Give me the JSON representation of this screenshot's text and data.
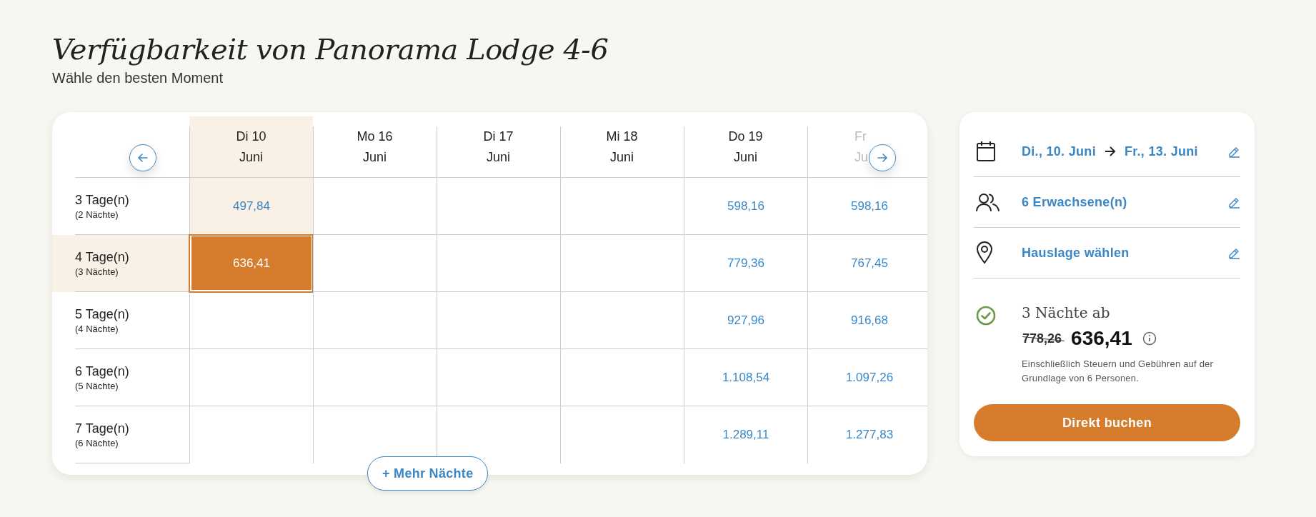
{
  "heading": {
    "title": "Verfügbarkeit von Panorama Lodge 4-6",
    "subtitle": "Wähle den besten Moment"
  },
  "calendar": {
    "columns": [
      {
        "day": "Di 10",
        "month": "Juni",
        "selected": true,
        "faded": false
      },
      {
        "day": "Mo 16",
        "month": "Juni",
        "selected": false,
        "faded": false
      },
      {
        "day": "Di 17",
        "month": "Juni",
        "selected": false,
        "faded": false
      },
      {
        "day": "Mi 18",
        "month": "Juni",
        "selected": false,
        "faded": false
      },
      {
        "day": "Do 19",
        "month": "Juni",
        "selected": false,
        "faded": false
      },
      {
        "day": "Fr",
        "month": "Ju",
        "selected": false,
        "faded": true
      }
    ],
    "rows": [
      {
        "label": "3 Tage(n)",
        "sublabel": "(2 Nächte)",
        "selected": false,
        "cells": [
          {
            "price": "497,84",
            "selected": false
          },
          null,
          null,
          null,
          {
            "price": "598,16",
            "selected": false
          },
          {
            "price": "598,16",
            "selected": false
          }
        ]
      },
      {
        "label": "4 Tage(n)",
        "sublabel": "(3 Nächte)",
        "selected": true,
        "cells": [
          {
            "price": "636,41",
            "selected": true
          },
          null,
          null,
          null,
          {
            "price": "779,36",
            "selected": false
          },
          {
            "price": "767,45",
            "selected": false
          }
        ]
      },
      {
        "label": "5 Tage(n)",
        "sublabel": "(4 Nächte)",
        "selected": false,
        "cells": [
          null,
          null,
          null,
          null,
          {
            "price": "927,96",
            "selected": false
          },
          {
            "price": "916,68",
            "selected": false
          }
        ]
      },
      {
        "label": "6 Tage(n)",
        "sublabel": "(5 Nächte)",
        "selected": false,
        "cells": [
          null,
          null,
          null,
          null,
          {
            "price": "1.108,54",
            "selected": false
          },
          {
            "price": "1.097,26",
            "selected": false
          }
        ]
      },
      {
        "label": "7 Tage(n)",
        "sublabel": "(6 Nächte)",
        "selected": false,
        "cells": [
          null,
          null,
          null,
          null,
          {
            "price": "1.289,11",
            "selected": false
          },
          {
            "price": "1.277,83",
            "selected": false
          }
        ]
      }
    ],
    "more_button": "+ Mehr Nächte"
  },
  "summary": {
    "items": [
      {
        "kind": "dates",
        "from": "Di., 10. Juni",
        "to": "Fr., 13. Juni"
      },
      {
        "kind": "guests",
        "text": "6 Erwachsene(n)"
      },
      {
        "kind": "location",
        "text": "Hauslage wählen"
      }
    ],
    "nights_label": "3 Nächte ab",
    "old_price": "778,26",
    "price": "636,41",
    "note": "Einschließlich Steuern und Gebühren auf der Grundlage von 6 Personen.",
    "book_button": "Direkt buchen"
  }
}
